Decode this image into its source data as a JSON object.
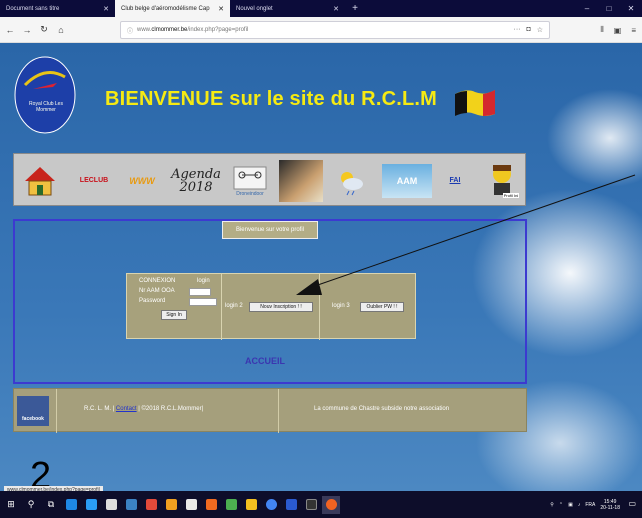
{
  "browser": {
    "tabs": [
      {
        "label": "Document sans titre",
        "active": false
      },
      {
        "label": "Club belge d'aéromodélisme Cap",
        "active": true
      },
      {
        "label": "Nouvel onglet",
        "active": false
      }
    ],
    "new_tab_glyph": "+",
    "url_prefix": "www.",
    "url_host": "clmommer.be",
    "url_path": "/index.php?page=profil",
    "url_more": "···",
    "window_controls": [
      "–",
      "□",
      "✕"
    ]
  },
  "header": {
    "logo_text": "Royal Club Les Mommer",
    "welcome": "BIENVENUE sur le site du R.C.L.M"
  },
  "menu": {
    "le_club": "LECLUB",
    "www": "WWW",
    "agenda": "Agenda",
    "agenda_year": "2018",
    "drone": "Droneindoor",
    "aam": "AAM",
    "fai": "FAI",
    "profil": "Profil Ini"
  },
  "content": {
    "profile_button": "Bienvenue sur votre profil",
    "connexion": "CONNEXION",
    "login_link": "login",
    "nr_label": "Nr AAM OOA",
    "password_label": "Password",
    "sign_in": "Sign In",
    "login2_label": "login 2",
    "new_inscription": "Nouv Inscription ! !",
    "login3_label": "login 3",
    "forgot_pw": "Oublier PW ! !",
    "accueil": "ACCUEIL"
  },
  "footer": {
    "facebook": "facebook",
    "rclm": "R.C. L. M. |",
    "contact": "Contact",
    "copyright": "| ©2018 R.C.L.Mommer|",
    "subsidy": "La commune de Chastre subside notre association"
  },
  "status_url": "www.clmommer.be/index.php?page=profil",
  "annotation_number": "2",
  "taskbar": {
    "lang": "FRA",
    "time": "15:49",
    "date": "20-11-18"
  },
  "colors": {
    "accent_yellow": "#f6ea12",
    "border_blue": "#3c3ad0",
    "panel_khaki": "#a7a17c",
    "sky_blue": "#2a66a8"
  }
}
